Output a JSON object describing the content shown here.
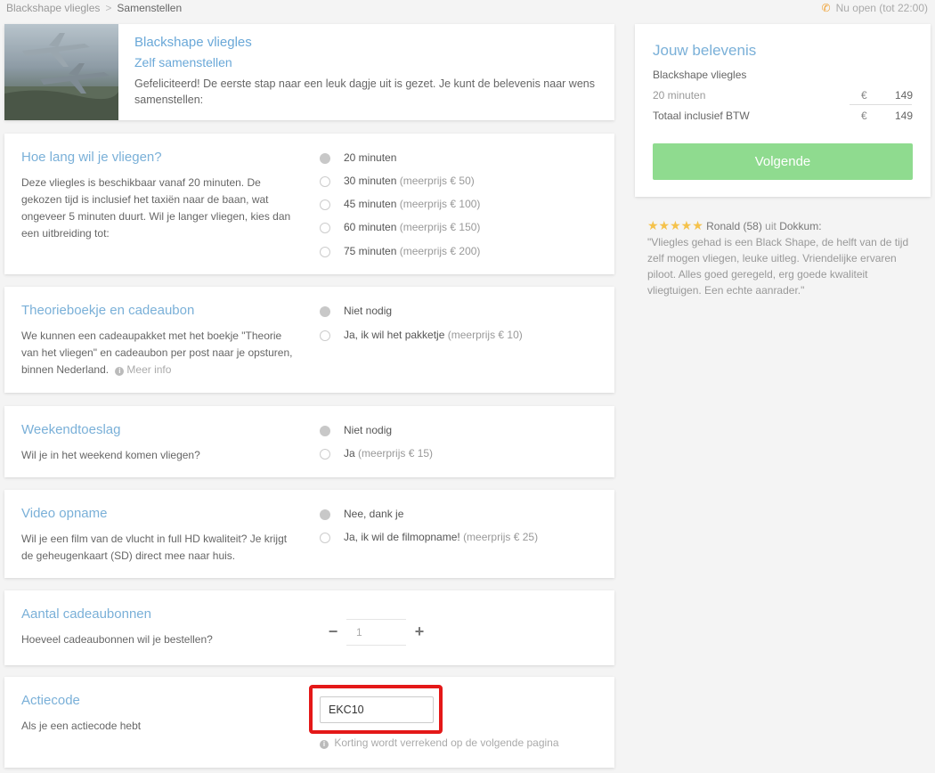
{
  "breadcrumb": {
    "items": [
      "Blackshape vliegles",
      "Samenstellen"
    ]
  },
  "open_status": "Nu open (tot 22:00)",
  "product": {
    "title": "Blackshape vliegles",
    "subtitle": "Zelf samenstellen",
    "description": "Gefeliciteerd! De eerste stap naar een leuk dagje uit is gezet. Je kunt de belevenis naar wens samenstellen:"
  },
  "sections": {
    "duration": {
      "title": "Hoe lang wil je vliegen?",
      "description": "Deze vliegles is beschikbaar vanaf 20 minuten. De gekozen tijd is inclusief het taxiën naar de baan, wat ongeveer 5 minuten duurt. Wil je langer vliegen, kies dan een uitbreiding tot:",
      "options": [
        {
          "label": "20 minuten",
          "extra": "",
          "selected": true
        },
        {
          "label": "30 minuten",
          "extra": "(meerprijs € 50)",
          "selected": false
        },
        {
          "label": "45 minuten",
          "extra": "(meerprijs € 100)",
          "selected": false
        },
        {
          "label": "60 minuten",
          "extra": "(meerprijs € 150)",
          "selected": false
        },
        {
          "label": "75 minuten",
          "extra": "(meerprijs € 200)",
          "selected": false
        }
      ]
    },
    "theory": {
      "title": "Theorieboekje en cadeaubon",
      "description": "We kunnen een cadeaupakket met het boekje \"Theorie van het vliegen\" en cadeaubon per post naar je opsturen, binnen Nederland.",
      "more_info": "Meer info",
      "options": [
        {
          "label": "Niet nodig",
          "extra": "",
          "selected": true
        },
        {
          "label": "Ja, ik wil het pakketje",
          "extra": "(meerprijs € 10)",
          "selected": false
        }
      ]
    },
    "weekend": {
      "title": "Weekendtoeslag",
      "description": "Wil je in het weekend komen vliegen?",
      "options": [
        {
          "label": "Niet nodig",
          "extra": "",
          "selected": true
        },
        {
          "label": "Ja",
          "extra": "(meerprijs € 15)",
          "selected": false
        }
      ]
    },
    "video": {
      "title": "Video opname",
      "description": "Wil je een film van de vlucht in full HD kwaliteit? Je krijgt de geheugenkaart (SD) direct mee naar huis.",
      "options": [
        {
          "label": "Nee, dank je",
          "extra": "",
          "selected": true
        },
        {
          "label": "Ja, ik wil de filmopname!",
          "extra": "(meerprijs € 25)",
          "selected": false
        }
      ]
    },
    "vouchers": {
      "title": "Aantal cadeaubonnen",
      "description": "Hoeveel cadeaubonnen wil je bestellen?",
      "minus": "−",
      "plus": "+",
      "quantity": "1"
    },
    "promo": {
      "title": "Actiecode",
      "description": "Als je een actiecode hebt",
      "value": "EKC10",
      "note": "Korting wordt verrekend op de volgende pagina"
    }
  },
  "summary": {
    "title": "Jouw belevenis",
    "product": "Blackshape vliegles",
    "rows": [
      {
        "label": "20 minuten",
        "currency": "€",
        "value": "149"
      },
      {
        "label": "Totaal inclusief BTW",
        "currency": "€",
        "value": "149"
      }
    ],
    "next_label": "Volgende"
  },
  "review": {
    "stars": "★★★★★",
    "name": "Ronald (58)",
    "from": "uit",
    "place": "Dokkum:",
    "text": "\"Vliegles gehad is een Black Shape, de helft van de tijd zelf mogen vliegen, leuke uitleg. Vriendelijke ervaren piloot. Alles goed geregeld, erg goede kwaliteit vliegtuigen. Een echte aanrader.\""
  },
  "colors": {
    "accent": "#7ab0d8",
    "button": "#8fdb8f",
    "highlight": "#e41818",
    "star": "#f5c24b"
  },
  "icons": [
    "phone-icon",
    "info-icon",
    "star-icon",
    "minus-icon",
    "plus-icon"
  ]
}
